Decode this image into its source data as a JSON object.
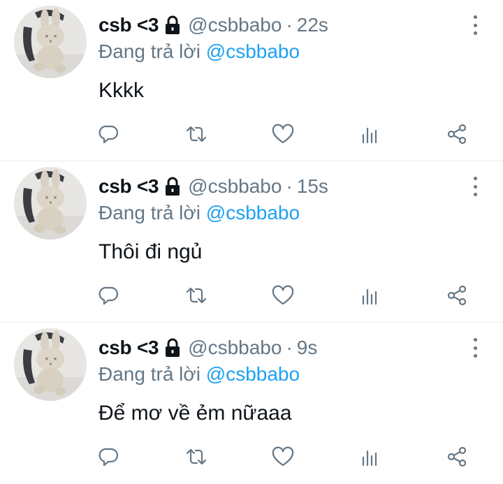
{
  "tweets": [
    {
      "display_name": "csb <3",
      "handle": "@csbbabo",
      "separator": "·",
      "time": "22s",
      "replying_prefix": "Đang trả lời",
      "replying_to": "@csbbabo",
      "text": "Kkkk"
    },
    {
      "display_name": "csb <3",
      "handle": "@csbbabo",
      "separator": "·",
      "time": "15s",
      "replying_prefix": "Đang trả lời",
      "replying_to": "@csbbabo",
      "text": "Thôi đi ngủ"
    },
    {
      "display_name": "csb <3",
      "handle": "@csbbabo",
      "separator": "·",
      "time": "9s",
      "replying_prefix": "Đang trả lời",
      "replying_to": "@csbbabo",
      "text": "Để mơ về ẻm nữaaa"
    }
  ],
  "icons": {
    "lock": "lock-icon",
    "more": "more-vertical-icon",
    "reply": "reply-icon",
    "retweet": "retweet-icon",
    "like": "heart-icon",
    "stats": "analytics-icon",
    "share": "share-icon"
  },
  "colors": {
    "text": "#0f1419",
    "secondary": "#657786",
    "link": "#1da1f2",
    "divider": "#e6ecf0"
  }
}
